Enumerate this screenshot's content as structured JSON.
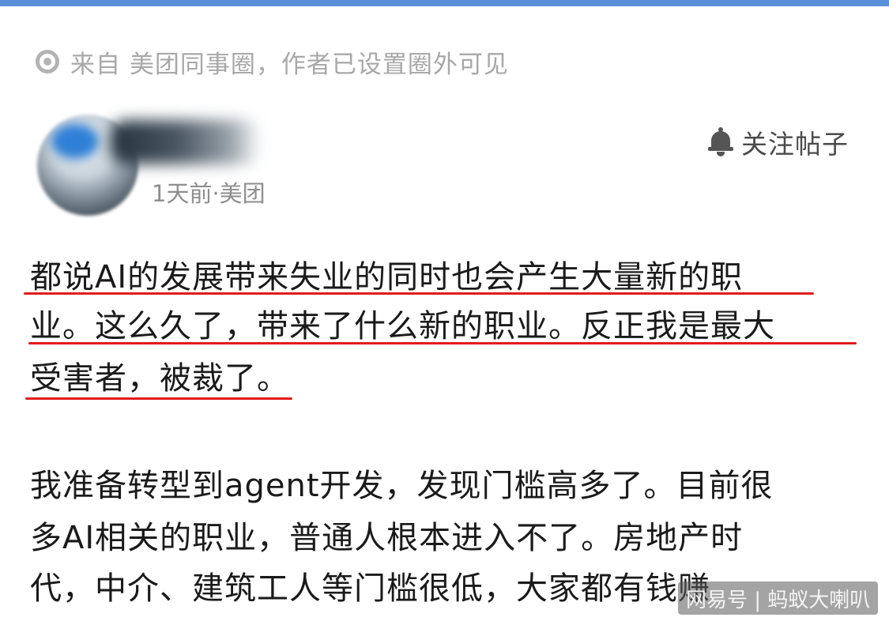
{
  "source": {
    "icon": "circle-dot-icon",
    "text": "来自 美团同事圈，作者已设置圈外可见"
  },
  "author": {
    "meta": "1天前·美团"
  },
  "follow": {
    "icon": "bell-icon",
    "label": "关注帖子"
  },
  "post": {
    "lines": [
      "都说AI的发展带来失业的同时也会产生大量新的职",
      "业。这么久了，带来了什么新的职业。反正我是最大",
      "受害者，被裁了。",
      "我准备转型到agent开发，发现门槛高多了。目前很",
      "多AI相关的职业，普通人根本进入不了。房地产时",
      "代，中介、建筑工人等门槛很低，大家都有钱赚"
    ]
  },
  "watermark": {
    "text": "网易号 | 蚂蚁大喇叭"
  },
  "colors": {
    "accent_bar": "#5b8fd9",
    "underline": "#e01c1c",
    "muted_text": "#a8a8a8"
  }
}
